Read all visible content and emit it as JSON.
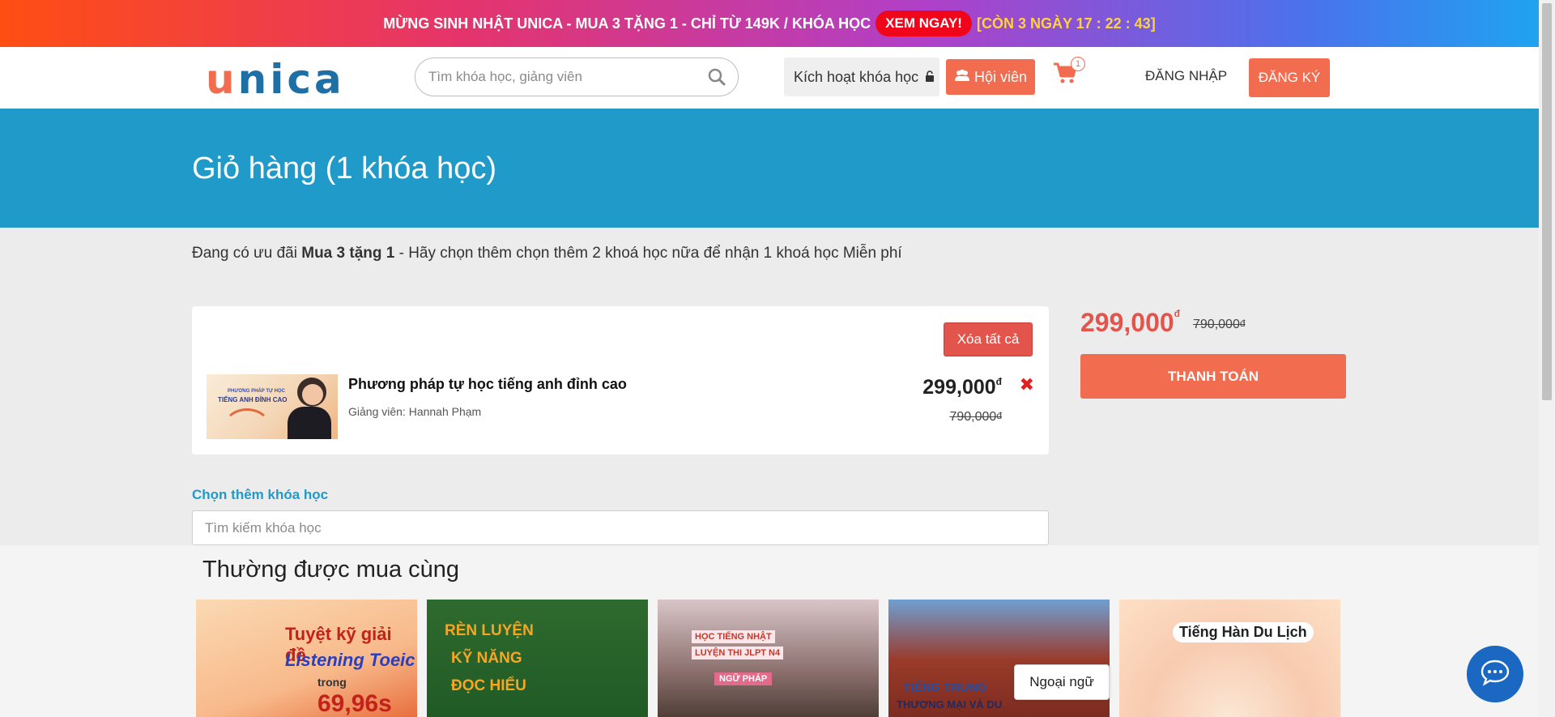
{
  "promo": {
    "text": "MỪNG SINH NHẬT UNICA - MUA 3 TẶNG 1 - CHỈ TỪ 149K / KHÓA HỌC",
    "cta": "XEM NGAY!",
    "countdown": "[CÒN 3 NGÀY 17 : 22 : 43]"
  },
  "header": {
    "logo_first": "u",
    "logo_rest": "nica",
    "search_placeholder": "Tìm khóa học, giảng viên",
    "activate_label": "Kích hoạt khóa học",
    "member_label": "Hội viên",
    "cart_count": "1",
    "login_label": "ĐĂNG NHẬP",
    "register_label": "ĐĂNG KÝ"
  },
  "page": {
    "title": "Giỏ hàng (1 khóa học)",
    "offer_prefix": "Đang có ưu đãi ",
    "offer_bold": "Mua 3 tặng 1",
    "offer_suffix": " - Hãy chọn thêm chọn thêm 2 khoá học nữa để nhận 1 khoá học Miễn phí"
  },
  "cart": {
    "clear_all_label": "Xóa tất cả",
    "items": [
      {
        "thumb_line1": "PHƯƠNG PHÁP TỰ HỌC",
        "thumb_line2": "TIẾNG ANH ĐỈNH CAO",
        "title": "Phương pháp tự học tiếng anh đỉnh cao",
        "teacher": "Giảng viên: Hannah Phạm",
        "price": "299,000",
        "old_price": "790,000",
        "currency": "đ"
      }
    ]
  },
  "add_more": {
    "title": "Chọn thêm khóa học",
    "search_placeholder": "Tìm kiếm khóa học"
  },
  "summary": {
    "total": "299,000",
    "total_old": "790,000",
    "currency": "đ",
    "checkout_label": "THANH TOÁN"
  },
  "related": {
    "title": "Thường được mua cùng",
    "courses": [
      {
        "lines": [
          "Tuyệt kỹ giải đề",
          "Listening Toeic",
          "trong",
          "69,96s"
        ]
      },
      {
        "lines": [
          "RÈN LUYỆN",
          "KỸ NĂNG",
          "ĐỌC HIỂU"
        ]
      },
      {
        "lines": [
          "HỌC TIẾNG NHẬT",
          "LUYỆN THI JLPT N4",
          "NGỮ PHÁP"
        ]
      },
      {
        "lines": [
          "TIẾNG TRUNG",
          "THƯƠNG MẠI VÀ DU"
        ]
      },
      {
        "lines": [
          "Tiếng Hàn Du Lịch"
        ]
      }
    ]
  },
  "tooltip": "Ngoại ngữ",
  "colors": {
    "accent": "#f26c4f",
    "hero": "#1f9ac9",
    "danger": "#e3554c",
    "chat": "#1a68c1"
  }
}
